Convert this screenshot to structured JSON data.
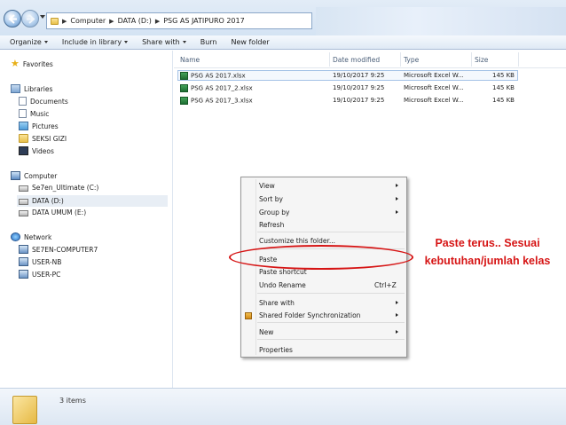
{
  "address": {
    "crumbs": [
      "Computer",
      "DATA (D:)",
      "PSG AS JATIPURO 2017"
    ]
  },
  "toolbar": {
    "organize": "Organize",
    "include": "Include in library",
    "share": "Share with",
    "burn": "Burn",
    "new_folder": "New folder"
  },
  "sidebar": {
    "favorites": "Favorites",
    "libraries": "Libraries",
    "documents": "Documents",
    "music": "Music",
    "pictures": "Pictures",
    "seksi_gizi": "SEKSI GIZI",
    "videos": "Videos",
    "computer": "Computer",
    "drive_c": "Se7en_Ultimate (C:)",
    "drive_d": "DATA (D:)",
    "drive_e": "DATA UMUM (E:)",
    "network": "Network",
    "net1": "SE7EN-COMPUTER7",
    "net2": "USER-NB",
    "net3": "USER-PC"
  },
  "columns": {
    "name": "Name",
    "date": "Date modified",
    "type": "Type",
    "size": "Size"
  },
  "files": [
    {
      "name": "PSG AS 2017.xlsx",
      "date": "19/10/2017 9:25",
      "type": "Microsoft Excel W...",
      "size": "145 KB"
    },
    {
      "name": "PSG AS 2017_2.xlsx",
      "date": "19/10/2017 9:25",
      "type": "Microsoft Excel W...",
      "size": "145 KB"
    },
    {
      "name": "PSG AS 2017_3.xlsx",
      "date": "19/10/2017 9:25",
      "type": "Microsoft Excel W...",
      "size": "145 KB"
    }
  ],
  "menu": {
    "view": "View",
    "sort_by": "Sort by",
    "group_by": "Group by",
    "refresh": "Refresh",
    "customize": "Customize this folder...",
    "paste": "Paste",
    "paste_shortcut": "Paste shortcut",
    "undo_rename": "Undo Rename",
    "undo_shortcut": "Ctrl+Z",
    "share_with": "Share with",
    "shared_sync": "Shared Folder Synchronization",
    "new": "New",
    "properties": "Properties"
  },
  "annotation": {
    "line1": "Paste terus.. Sesuai",
    "line2": "kebutuhan/jumlah kelas",
    "color": "#d61515"
  },
  "status": {
    "items": "3 items"
  }
}
